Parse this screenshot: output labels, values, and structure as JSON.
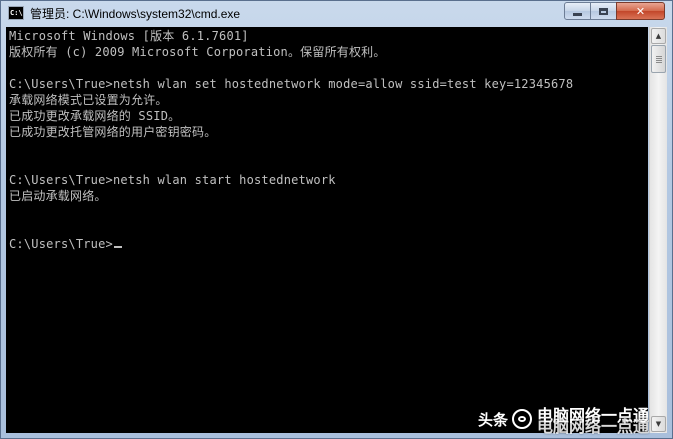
{
  "window": {
    "title": "管理员: C:\\Windows\\system32\\cmd.exe",
    "icon_label": "C:\\"
  },
  "buttons": {
    "minimize": "minimize",
    "maximize": "maximize",
    "close": "✕"
  },
  "console": {
    "lines": [
      "Microsoft Windows [版本 6.1.7601]",
      "版权所有 (c) 2009 Microsoft Corporation。保留所有权利。",
      "",
      "C:\\Users\\True>netsh wlan set hostednetwork mode=allow ssid=test key=12345678",
      "承载网络模式已设置为允许。",
      "已成功更改承载网络的 SSID。",
      "已成功更改托管网络的用户密钥密码。",
      "",
      "",
      "C:\\Users\\True>netsh wlan start hostednetwork",
      "已启动承载网络。",
      "",
      "",
      "C:\\Users\\True>"
    ],
    "text_color": "#c0c0c0",
    "background": "#000000"
  },
  "scrollbar": {
    "up_arrow": "▲",
    "down_arrow": "▼"
  },
  "watermark": {
    "brand": "头条",
    "line1": "电脑网络一点通",
    "line2": "电脑网络一点通"
  }
}
